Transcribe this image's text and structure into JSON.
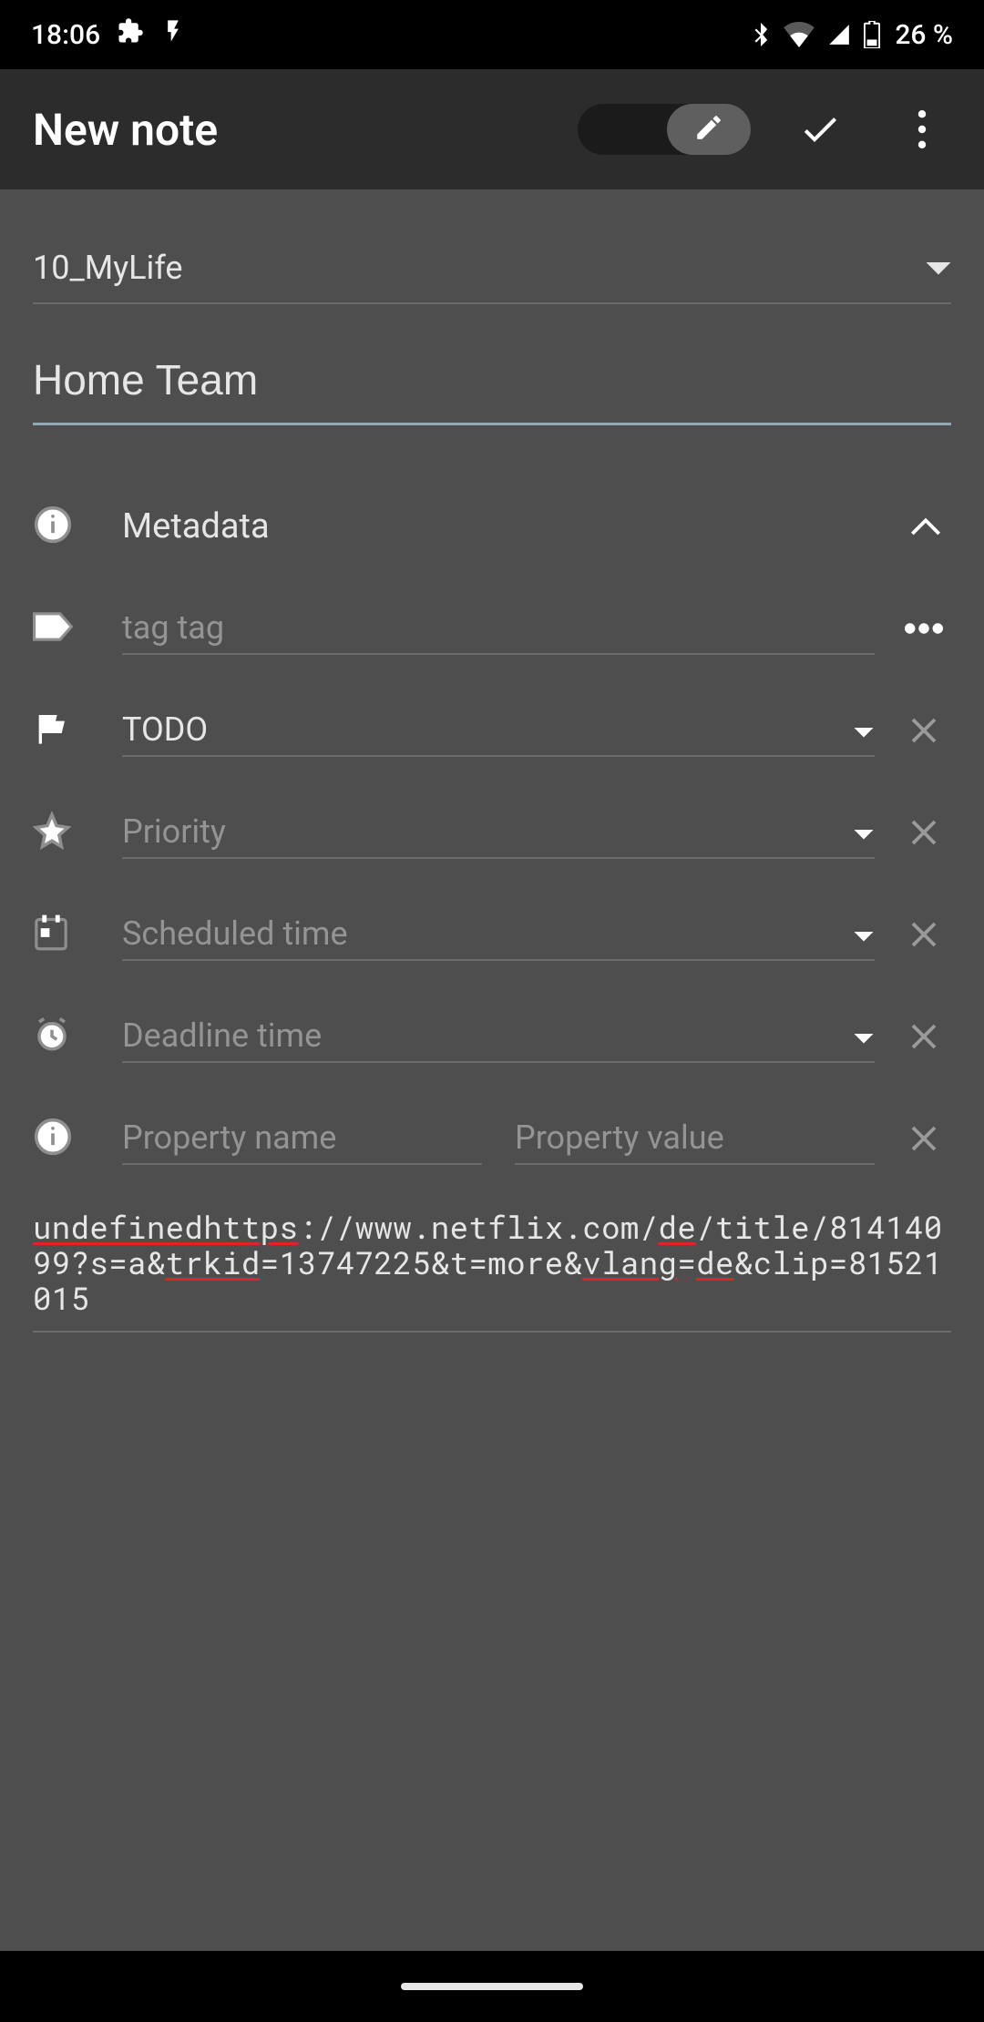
{
  "status": {
    "time": "18:06",
    "battery": "26 %"
  },
  "toolbar": {
    "title": "New note"
  },
  "notebook": {
    "selected": "10_MyLife"
  },
  "note": {
    "title": "Home Team",
    "body_segments": [
      {
        "t": "undefinedhttps",
        "spell": true
      },
      {
        "t": "://www.netflix.com/"
      },
      {
        "t": "de",
        "spell": true
      },
      {
        "t": "/title/81414099?s=a&"
      },
      {
        "t": "trkid",
        "spell": true
      },
      {
        "t": "=13747225&t=more&"
      },
      {
        "t": "vlang",
        "spell": true
      },
      {
        "t": "="
      },
      {
        "t": "de",
        "spell": true
      },
      {
        "t": "&clip=81521015"
      }
    ]
  },
  "metadata": {
    "header": "Metadata",
    "tags_placeholder": "tag tag",
    "state_value": "TODO",
    "priority_placeholder": "Priority",
    "scheduled_placeholder": "Scheduled time",
    "deadline_placeholder": "Deadline time",
    "property_name_placeholder": "Property name",
    "property_value_placeholder": "Property value"
  }
}
